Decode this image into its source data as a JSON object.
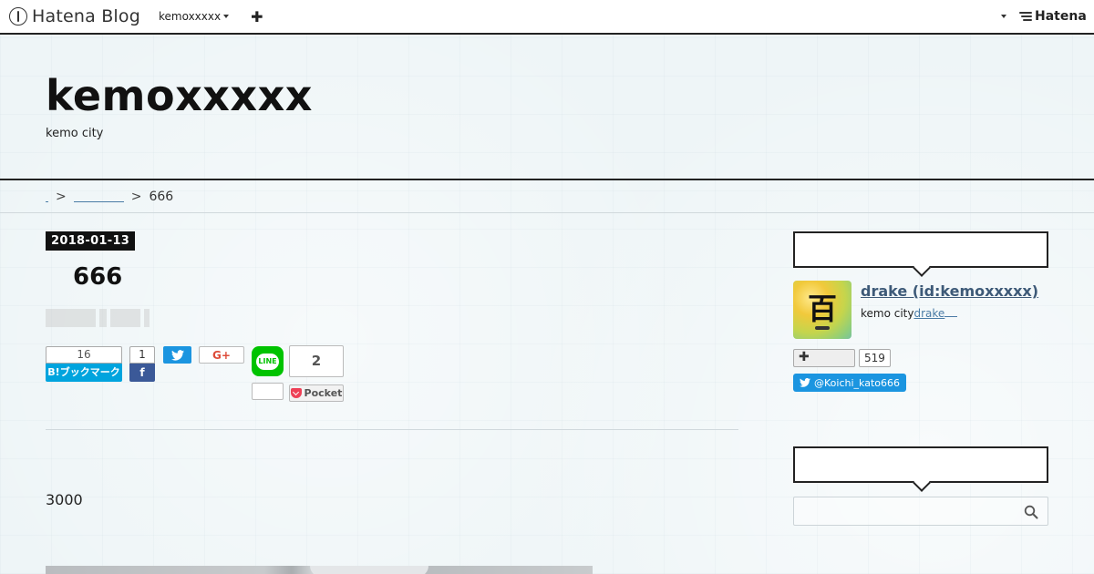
{
  "navbar": {
    "brand": "Hatena Blog",
    "blog_menu": "kemoxxxxx",
    "add_label": "✚",
    "hatena_logo": "Hatena"
  },
  "header": {
    "title": "kemoxxxxx",
    "description": "kemo city"
  },
  "breadcrumb": {
    "current": "666",
    "separator": ">"
  },
  "entry": {
    "date": "2018-01-13",
    "title": "666",
    "body_text": "3000"
  },
  "share": {
    "hatena_count": "16",
    "hatena_label": "B!ブックマーク",
    "facebook_count": "1",
    "facebook_label": "f",
    "twitter_label": "🐦",
    "gplus_label": "G+",
    "line_label": "LINE",
    "pocket_count": "2",
    "pocket_label": "Pocket"
  },
  "sidebar": {
    "profile": {
      "icon_char": "百",
      "name": "drake (id:kemoxxxxx)",
      "description": "kemo city",
      "description_link": "drake",
      "follow_label": "✚",
      "follow_count": "519",
      "twitter_label": "@Koichi_kato666"
    },
    "search": {
      "placeholder": ""
    }
  },
  "colors": {
    "hatena_blue": "#00a4de",
    "facebook_blue": "#3b5998",
    "twitter_blue": "#1b95e0",
    "gplus_red": "#dd4b39",
    "line_green": "#00c300",
    "pocket_red": "#ee4056",
    "link": "#4a7ba5"
  }
}
